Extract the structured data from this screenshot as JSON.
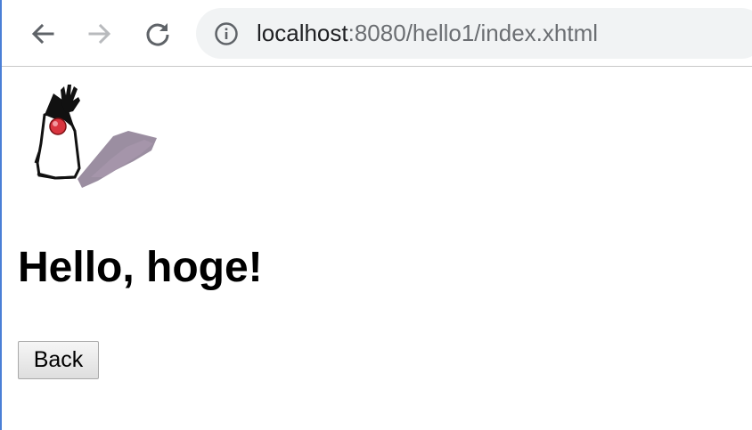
{
  "browser": {
    "url_host": "localhost",
    "url_path": ":8080/hello1/index.xhtml",
    "icons": {
      "back": "arrow-left-icon",
      "forward": "arrow-right-icon",
      "reload": "reload-icon",
      "info": "info-icon"
    }
  },
  "page": {
    "logo": "duke-mascot",
    "heading": "Hello, hoge!",
    "back_button_label": "Back"
  },
  "colors": {
    "accent_border": "#4a7fd6",
    "omnibox_bg": "#f1f3f4",
    "url_path": "#6b6e72"
  }
}
